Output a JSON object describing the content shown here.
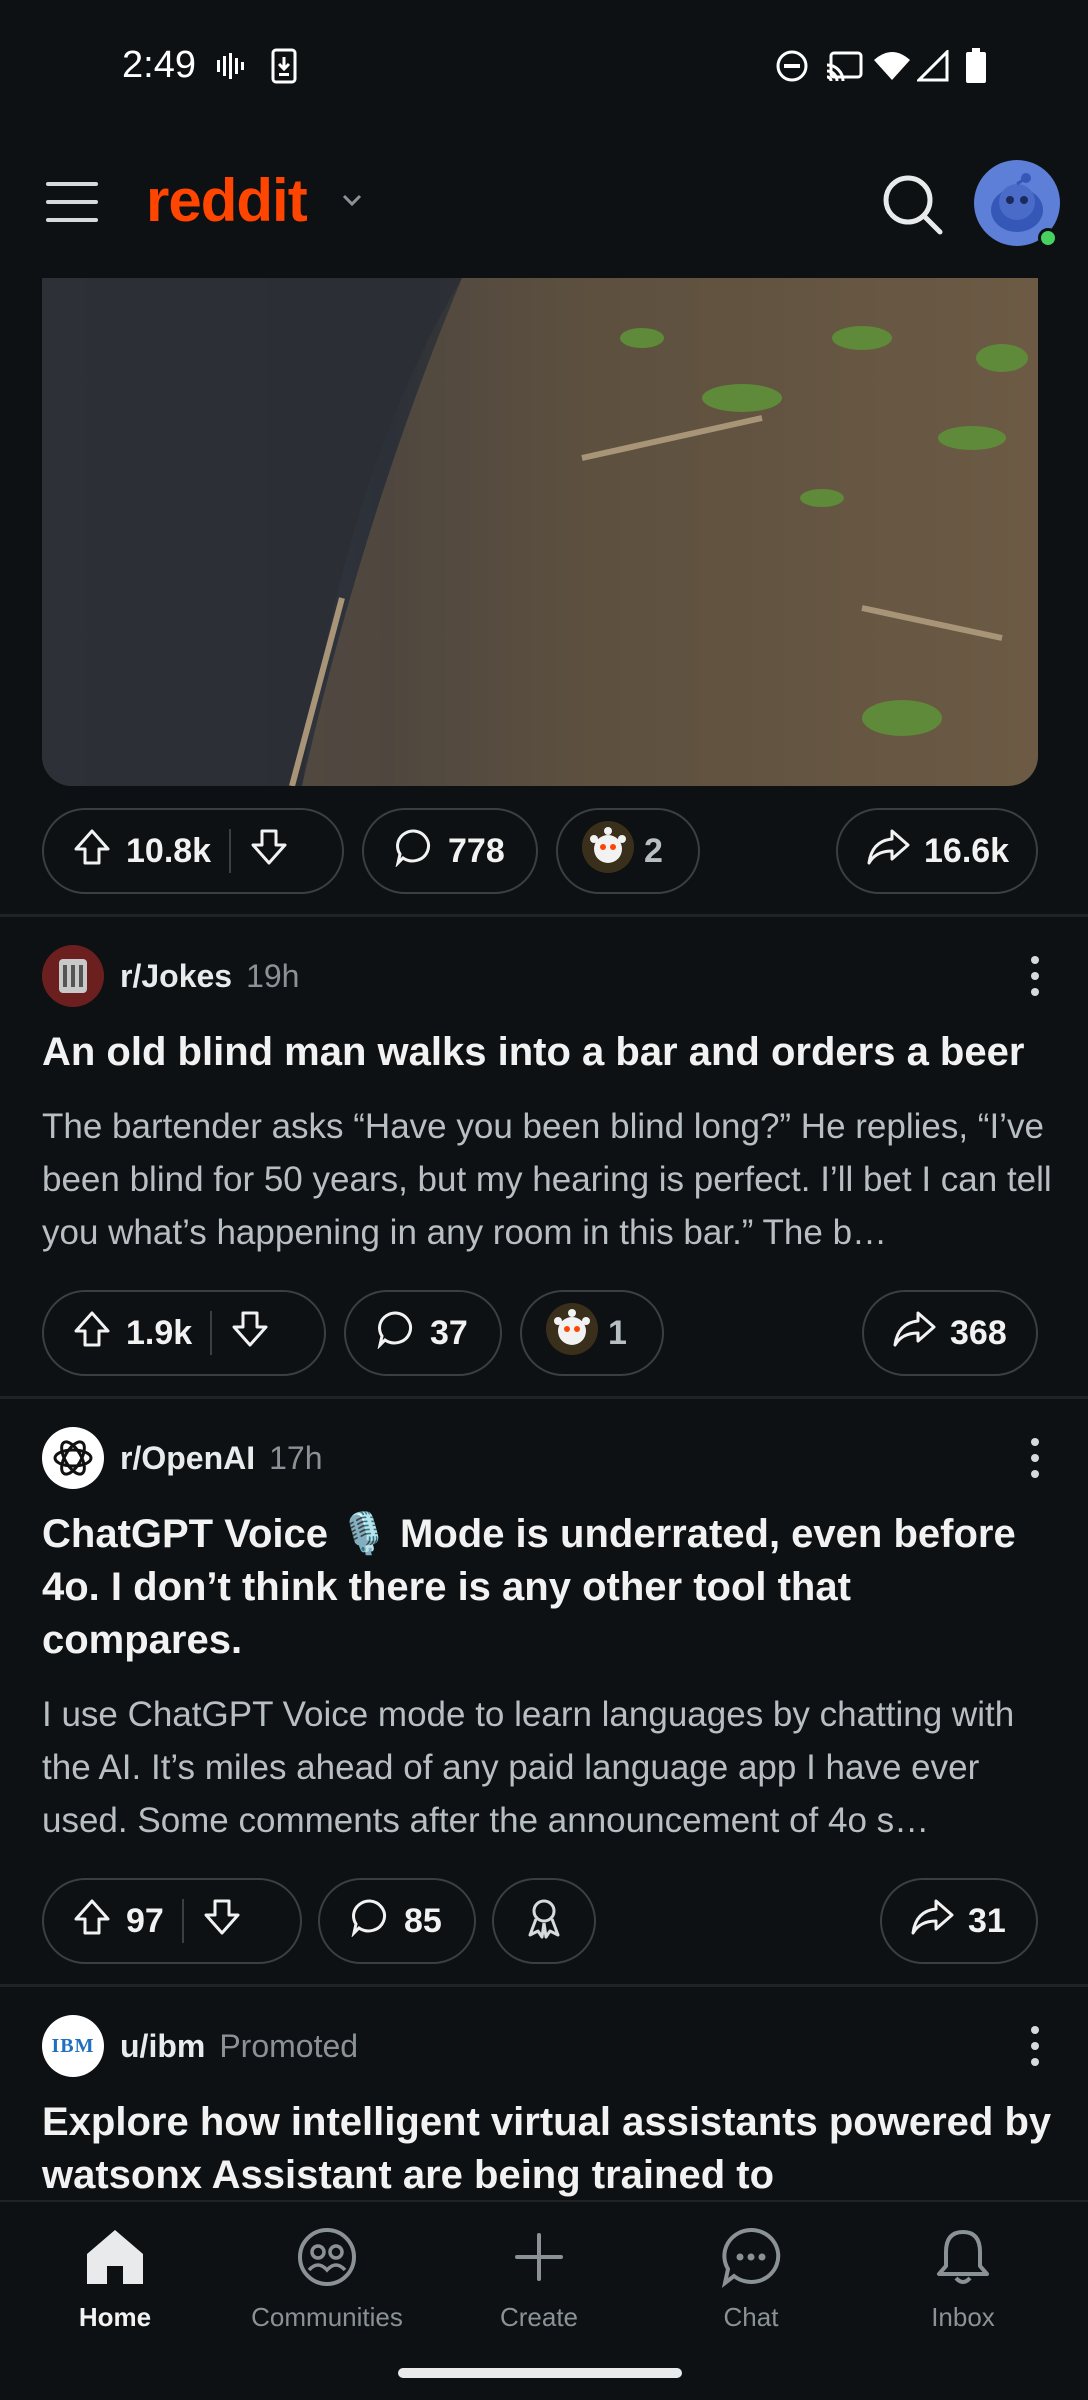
{
  "status_bar": {
    "time": "2:49"
  },
  "header": {
    "logo_text": "reddit"
  },
  "posts": [
    {
      "upvotes": "10.8k",
      "comments": "778",
      "awards": "2",
      "shares": "16.6k"
    },
    {
      "subreddit": "r/Jokes",
      "time": "19h",
      "title": "An old blind man walks into a bar and orders a beer",
      "body": "The bartender asks “Have you been blind long?” He replies, “I’ve been blind for 50 years, but my hearing is perfect. I’ll bet I can tell you what’s happening in any room in this bar.” The b…",
      "upvotes": "1.9k",
      "comments": "37",
      "awards": "1",
      "shares": "368"
    },
    {
      "subreddit": "r/OpenAI",
      "time": "17h",
      "title": "ChatGPT Voice 🎙️ Mode is underrated, even before 4o. I don’t think there is any other tool that compares.",
      "body": "I use ChatGPT Voice mode to learn languages by chatting with the AI. It’s miles ahead of any paid language app I have ever used. Some comments after the announcement of 4o s…",
      "upvotes": "97",
      "comments": "85",
      "shares": "31"
    },
    {
      "subreddit": "u/ibm",
      "time": "Promoted",
      "icon_text": "IBM",
      "title": "Explore how intelligent virtual assistants powered by watsonx Assistant are being trained to"
    }
  ],
  "bottom_nav": {
    "items": [
      {
        "label": "Home",
        "icon": "home-icon",
        "active": true
      },
      {
        "label": "Communities",
        "icon": "communities-icon"
      },
      {
        "label": "Create",
        "icon": "plus-icon"
      },
      {
        "label": "Chat",
        "icon": "chat-icon"
      },
      {
        "label": "Inbox",
        "icon": "bell-icon"
      }
    ]
  },
  "colors": {
    "background": "#0e1113",
    "brand": "#ff4500",
    "pill_border": "#3a3f43",
    "muted_text": "#8a9296"
  }
}
